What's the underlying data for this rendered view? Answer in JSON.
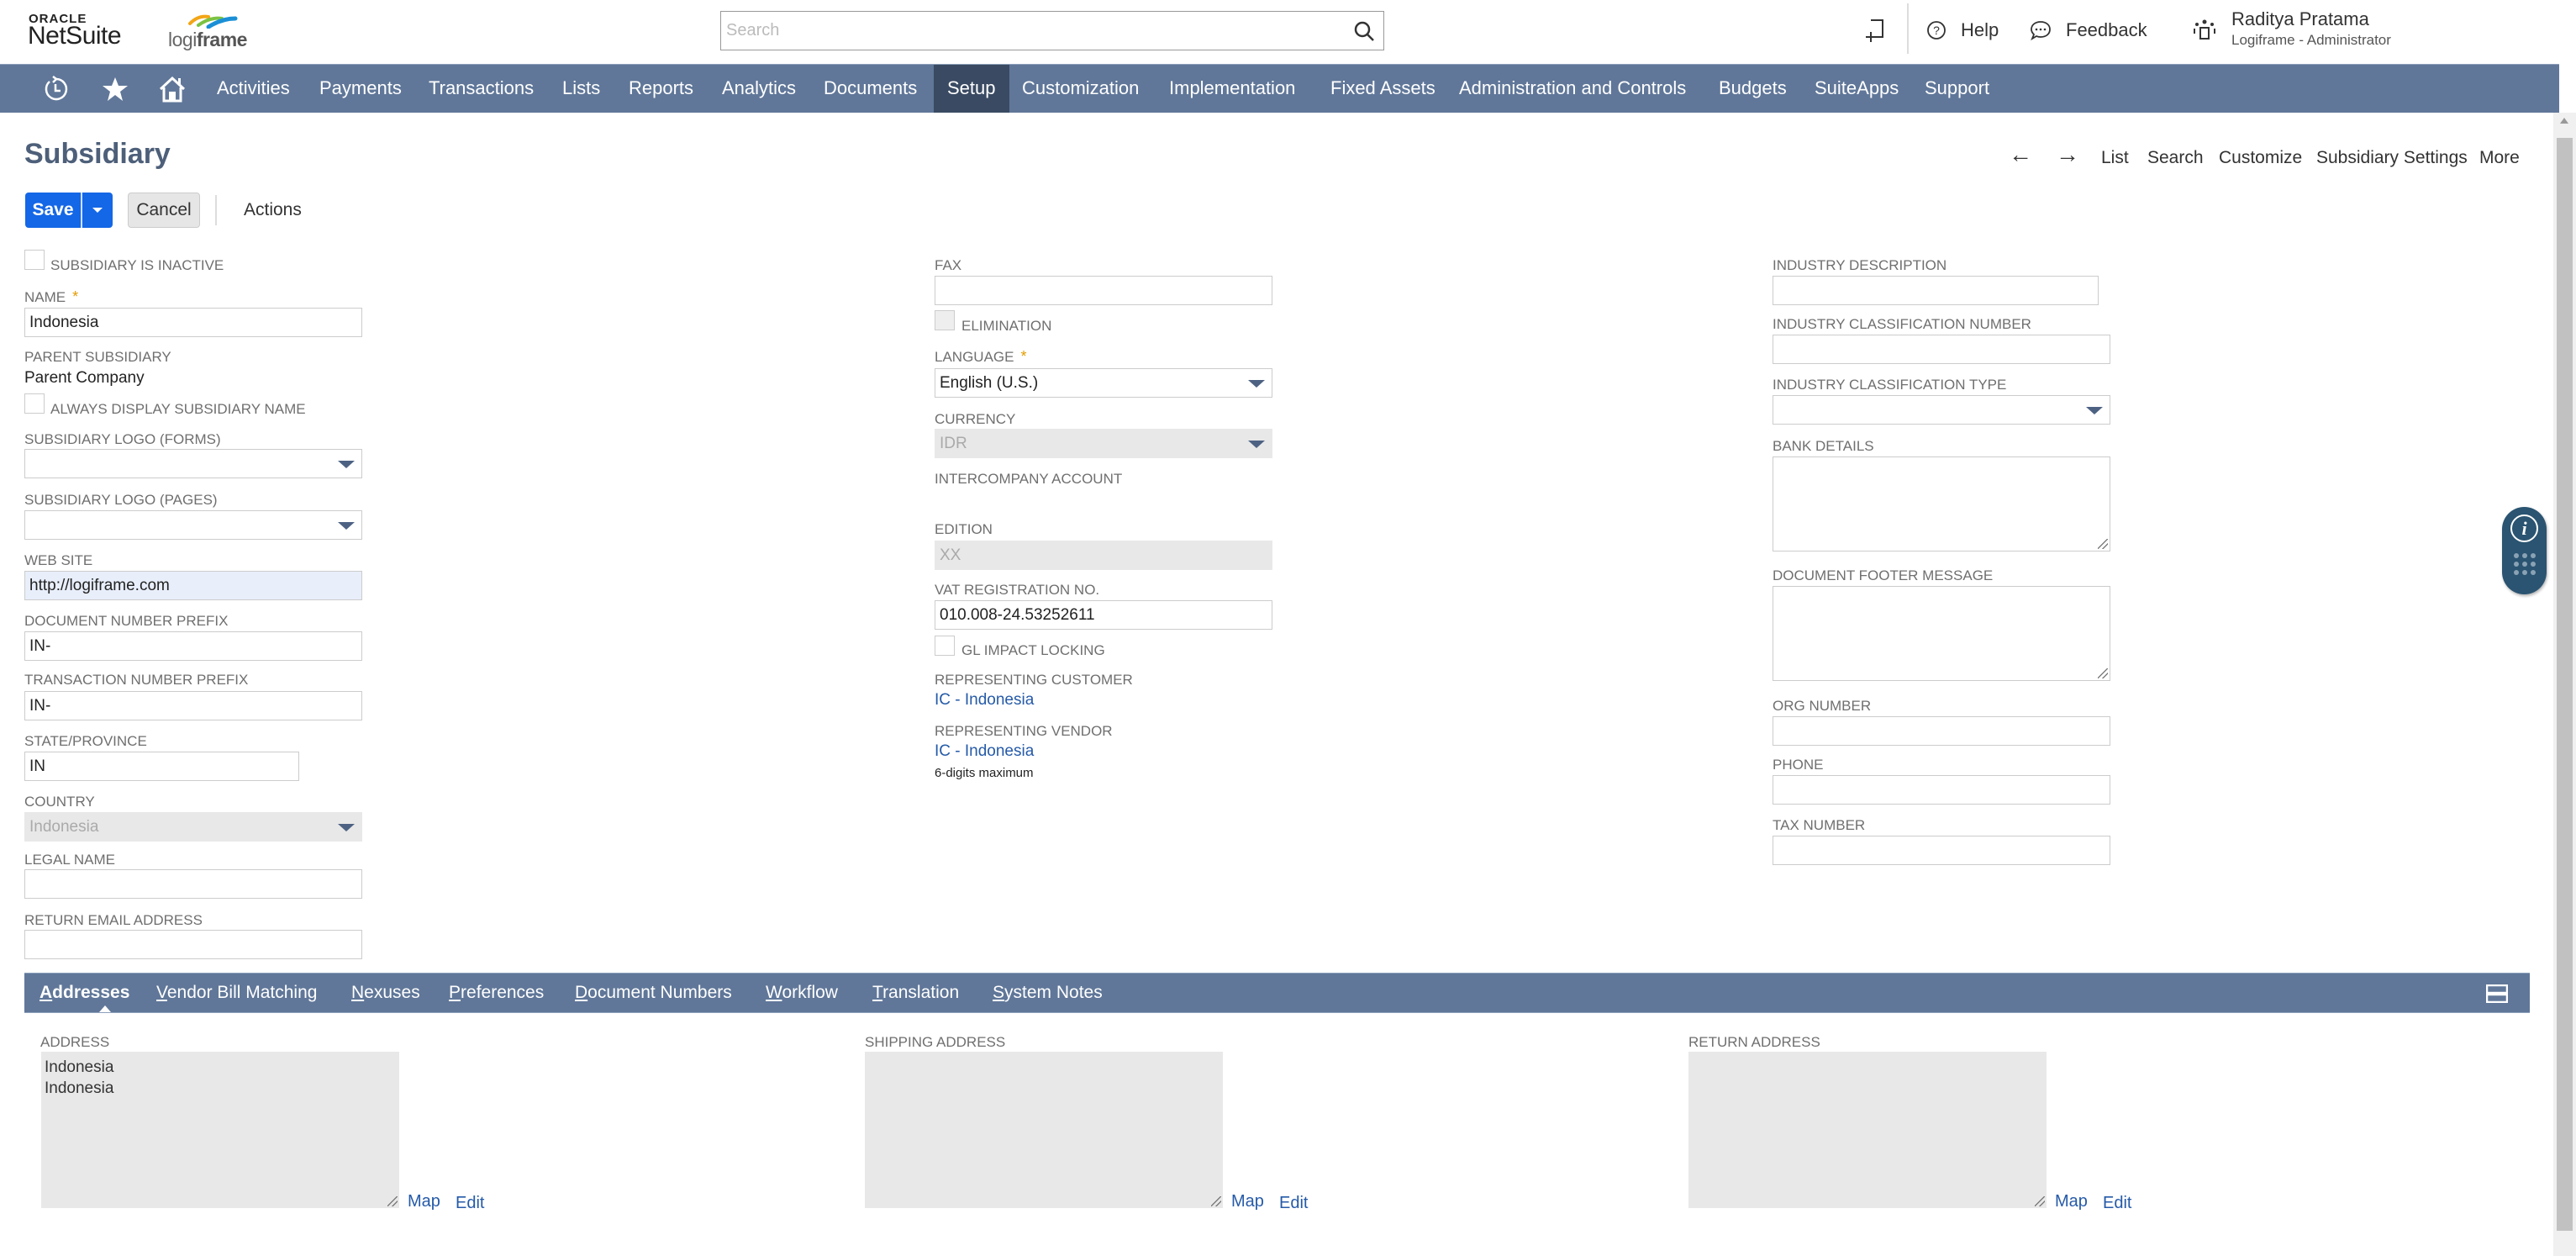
{
  "header": {
    "brand_top": "ORACLE",
    "brand_name": "NetSuite",
    "company_logo_light": "logi",
    "company_logo_bold": "frame",
    "search_placeholder": "Search",
    "search_value": "",
    "help_label": "Help",
    "feedback_label": "Feedback",
    "user_name": "Raditya Pratama",
    "user_role": "Logiframe - Administrator",
    "icons": [
      "recent-records-icon",
      "help-icon",
      "feedback-icon",
      "role-switch-icon"
    ]
  },
  "nav": {
    "icons": [
      "history-icon",
      "star-icon",
      "home-icon"
    ],
    "items": [
      {
        "label": "Activities"
      },
      {
        "label": "Payments"
      },
      {
        "label": "Transactions"
      },
      {
        "label": "Lists"
      },
      {
        "label": "Reports"
      },
      {
        "label": "Analytics"
      },
      {
        "label": "Documents"
      },
      {
        "label": "Setup",
        "active": true
      },
      {
        "label": "Customization"
      },
      {
        "label": "Implementation"
      },
      {
        "label": "Fixed Assets"
      },
      {
        "label": "Administration and Controls"
      },
      {
        "label": "Budgets"
      },
      {
        "label": "SuiteApps"
      },
      {
        "label": "Support"
      }
    ],
    "active_color": "#3a4a62",
    "bar_color": "#607799"
  },
  "page": {
    "title": "Subsidiary",
    "links": {
      "back": "←",
      "forward": "→",
      "list": "List",
      "search": "Search",
      "customize": "Customize",
      "settings": "Subsidiary Settings",
      "more": "More"
    },
    "toolbar": {
      "save_label": "Save",
      "cancel_label": "Cancel",
      "actions_label": "Actions"
    }
  },
  "form": {
    "col1": {
      "inactive": {
        "label": "Subsidiary is inactive",
        "checked": false
      },
      "name": {
        "label": "Name",
        "required": "*",
        "value": "Indonesia"
      },
      "parent": {
        "label": "Parent Subsidiary",
        "value": "Parent Company"
      },
      "always_display": {
        "label": "Always display subsidiary name",
        "checked": false
      },
      "logo_forms": {
        "label": "Subsidiary Logo (Forms)",
        "value": ""
      },
      "logo_pages": {
        "label": "Subsidiary Logo (Pages)",
        "value": ""
      },
      "website": {
        "label": "Web Site",
        "value": "http://logiframe.com"
      },
      "doc_prefix": {
        "label": "Document Number Prefix",
        "value": "IN-"
      },
      "txn_prefix": {
        "label": "Transaction Number Prefix",
        "value": "IN-"
      },
      "state": {
        "label": "State/Province",
        "value": "IN"
      },
      "country": {
        "label": "Country",
        "value": "Indonesia"
      },
      "legal_name": {
        "label": "Legal Name",
        "value": ""
      },
      "return_email": {
        "label": "Return Email Address",
        "value": ""
      }
    },
    "col2": {
      "fax": {
        "label": "Fax",
        "value": ""
      },
      "elimination": {
        "label": "Elimination",
        "checked": false
      },
      "language": {
        "label": "Language",
        "required": "*",
        "value": "English (U.S.)"
      },
      "currency": {
        "label": "Currency",
        "value": "IDR"
      },
      "intercompany": {
        "label": "Intercompany Account",
        "value": ""
      },
      "edition": {
        "label": "Edition",
        "value": "XX"
      },
      "vat": {
        "label": "VAT Registration No.",
        "value": "010.008-24.53252611"
      },
      "gl_locking": {
        "label": "GL Impact Locking",
        "checked": false
      },
      "rep_customer": {
        "label": "Representing Customer",
        "value": "IC - Indonesia"
      },
      "rep_vendor": {
        "label": "Representing Vendor",
        "value": "IC - Indonesia"
      },
      "hint": "6-digits maximum"
    },
    "col3": {
      "industry_desc": {
        "label": "Industry Description",
        "value": ""
      },
      "industry_class_num": {
        "label": "Industry Classification Number",
        "value": ""
      },
      "industry_class_type": {
        "label": "Industry Classification Type",
        "value": ""
      },
      "bank_details": {
        "label": "Bank Details",
        "value": ""
      },
      "footer_msg": {
        "label": "Document Footer Message",
        "value": ""
      },
      "org_number": {
        "label": "Org Number",
        "value": ""
      },
      "phone": {
        "label": "Phone",
        "value": ""
      },
      "tax_number": {
        "label": "Tax Number",
        "value": ""
      }
    }
  },
  "subtabs": {
    "items": [
      {
        "first": "A",
        "rest": "ddresses",
        "active": true
      },
      {
        "first": "V",
        "rest": "endor Bill Matching"
      },
      {
        "first": "N",
        "rest": "exuses"
      },
      {
        "first": "P",
        "rest": "references"
      },
      {
        "first": "D",
        "rest": "ocument Numbers"
      },
      {
        "first": "W",
        "rest": "orkflow"
      },
      {
        "first": "T",
        "rest": "ranslation"
      },
      {
        "first": "S",
        "rest": "ystem Notes"
      }
    ]
  },
  "addresses": {
    "address": {
      "label": "Address",
      "lines": [
        "Indonesia",
        "Indonesia"
      ]
    },
    "shipping": {
      "label": "Shipping Address",
      "lines": []
    },
    "return": {
      "label": "Return Address",
      "lines": []
    },
    "map_label": "Map",
    "edit_label": "Edit"
  },
  "widget": {
    "info_glyph": "i"
  }
}
